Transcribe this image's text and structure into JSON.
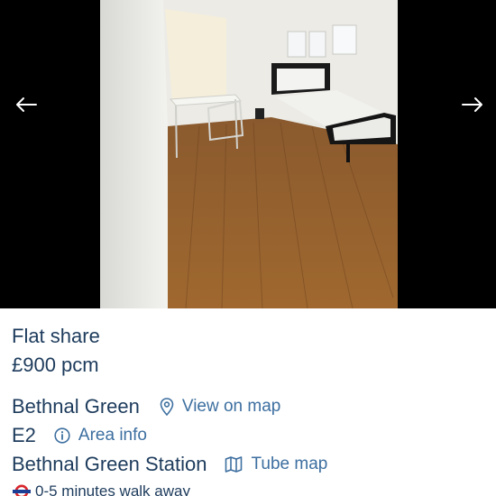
{
  "listing": {
    "type": "Flat share",
    "price": "£900 pcm",
    "area": "Bethnal Green",
    "view_on_map": "View on map",
    "postcode": "E2",
    "area_info": "Area info",
    "station": "Bethnal Green Station",
    "tube_map": "Tube map",
    "walk": "0-5 minutes walk away"
  },
  "gallery": {
    "prev_icon": "arrow-left-icon",
    "next_icon": "arrow-right-icon"
  },
  "icons": {
    "view_on_map": "location-pin-icon",
    "area_info": "info-circle-icon",
    "tube_map": "map-icon",
    "station": "tube-roundel-icon"
  }
}
